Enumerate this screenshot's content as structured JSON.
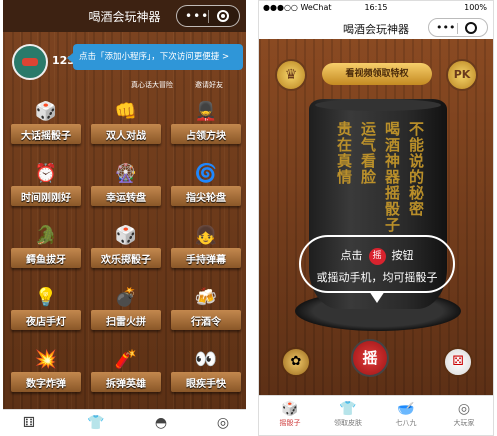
{
  "left": {
    "title": "喝酒会玩神器",
    "user_number": "123",
    "tip": "点击「添加小程序」，下次访问更便捷 >",
    "links": [
      "真心话大冒险",
      "邀请好友"
    ],
    "games": [
      {
        "label": "大话摇骰子",
        "icon": "dice-cup-icon",
        "glyph": "🎲"
      },
      {
        "label": "双人对战",
        "icon": "versus-icon",
        "glyph": "👊"
      },
      {
        "label": "占领方块",
        "icon": "soldier-icon",
        "glyph": "💂"
      },
      {
        "label": "时间刚刚好",
        "icon": "clock-icon",
        "glyph": "⏰"
      },
      {
        "label": "幸运转盘",
        "icon": "wheel-icon",
        "glyph": "🎡"
      },
      {
        "label": "指尖轮盘",
        "icon": "spinner-icon",
        "glyph": "🌀"
      },
      {
        "label": "鳄鱼拔牙",
        "icon": "crocodile-icon",
        "glyph": "🐊"
      },
      {
        "label": "欢乐掷骰子",
        "icon": "dice-icon",
        "glyph": "🎲"
      },
      {
        "label": "手持弹幕",
        "icon": "girl-icon",
        "glyph": "👧"
      },
      {
        "label": "夜店手灯",
        "icon": "light-icon",
        "glyph": "💡"
      },
      {
        "label": "扫雷火拼",
        "icon": "bomb-icon",
        "glyph": "💣"
      },
      {
        "label": "行酒令",
        "icon": "toast-icon",
        "glyph": "🍻"
      },
      {
        "label": "数字炸弹",
        "icon": "number-bomb-icon",
        "glyph": "💥"
      },
      {
        "label": "拆弹英雄",
        "icon": "defuse-icon",
        "glyph": "🧨"
      },
      {
        "label": "眼疾手快",
        "icon": "eyes-icon",
        "glyph": "👀"
      }
    ],
    "bottom_icons": [
      "dice-tab-icon",
      "shirt-tab-icon",
      "bowl-tab-icon",
      "discover-tab-icon"
    ]
  },
  "right": {
    "status_carrier": "●●●○○ WeChat",
    "status_time": "16:15",
    "status_battery": "100%",
    "title": "喝酒会玩神器",
    "vip_button": "看视频领取特权",
    "pk_label": "PK",
    "shake_label": "摇",
    "hint_line1_a": "点击",
    "hint_line1_b": "按钮",
    "hint_line2": "或摇动手机，均可摇骰子",
    "calligraphy": [
      "不能说的秘密",
      "喝酒神器摇骰子",
      "运气看脸",
      "贵在真情"
    ],
    "tabs": [
      {
        "label": "摇骰子",
        "glyph": "🎲",
        "active": true
      },
      {
        "label": "领取皮肤",
        "glyph": "👕",
        "active": false
      },
      {
        "label": "七八九",
        "glyph": "🥣",
        "active": false
      },
      {
        "label": "大玩家",
        "glyph": "◎",
        "active": false
      }
    ]
  }
}
